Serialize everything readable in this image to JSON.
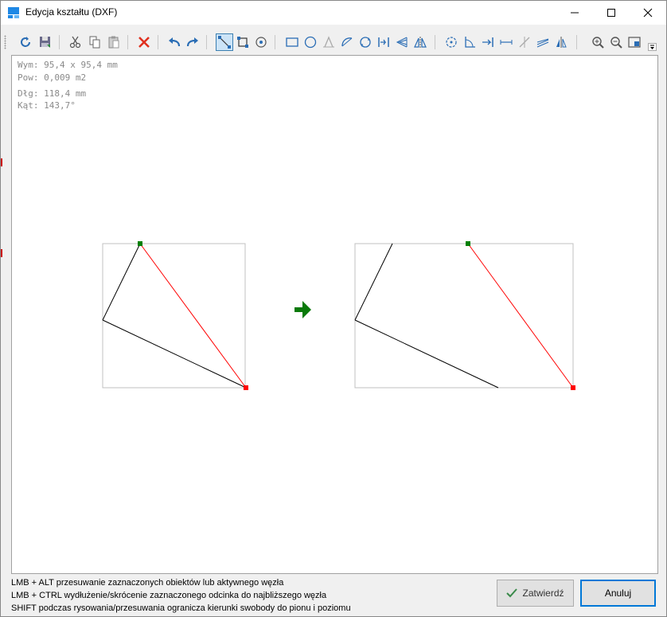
{
  "window": {
    "title": "Edycja kształtu (DXF)",
    "controls": {
      "minimize": "minimize-icon",
      "maximize": "maximize-icon",
      "close": "close-icon"
    }
  },
  "toolbar": {
    "groups": [
      [
        "undo-icon",
        "save-icon"
      ],
      [
        "cut-icon",
        "copy-icon",
        "paste-icon"
      ],
      [
        "delete-icon"
      ],
      [
        "undo-arrow-icon",
        "redo-arrow-icon"
      ],
      [
        "select-line-icon",
        "select-box-icon",
        "zoom-select-icon"
      ],
      [
        "rectangle-icon",
        "circle-icon",
        "chamfer-icon",
        "arc-icon",
        "rotate-icon",
        "align-icon",
        "fan-icon",
        "mirror-icon"
      ],
      [
        "rotate-node-icon",
        "angle-icon",
        "extend-icon",
        "measure-icon",
        "trim-icon",
        "hatch-icon",
        "mirror-axis-icon"
      ],
      [
        "zoom-in-icon",
        "zoom-out-icon",
        "zoom-fit-icon"
      ]
    ]
  },
  "info": {
    "dimensions": "Wym: 95,4 x 95,4 mm",
    "area": "Pow: 0,009 m2",
    "length": "Dłg: 118,4 mm",
    "angle": "Kąt: 143,7°"
  },
  "status_hints": [
    "LMB + ALT przesuwanie zaznaczonych obiektów lub aktywnego węzła",
    "LMB + CTRL wydłużenie/skrócenie zaznaczonego odcinka do najbliższego węzła",
    "SHIFT podczas rysowania/przesuwania ogranicza kierunki swobody do pionu i poziomu"
  ],
  "buttons": {
    "confirm": "Zatwierdź",
    "cancel": "Anuluj"
  },
  "colors": {
    "selected_line": "#ff0000",
    "start_node": "#008000",
    "end_node": "#ff0000",
    "arrow": "#0a7a0a",
    "accent": "#0078d7"
  }
}
